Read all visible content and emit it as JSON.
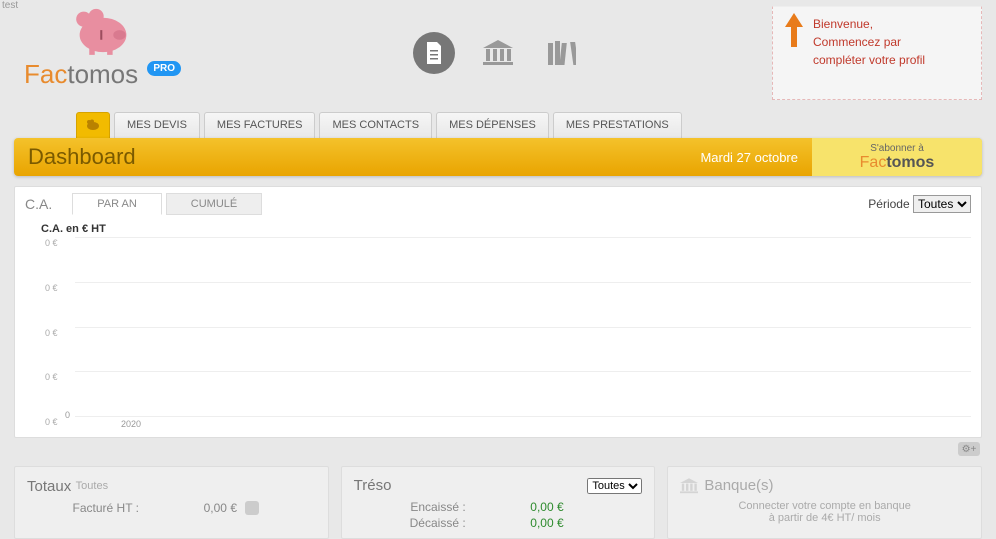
{
  "meta": {
    "test": "test"
  },
  "brand": {
    "fac": "Fac",
    "tomos": "tomos",
    "pro": "PRO"
  },
  "welcome": {
    "line1": "Bienvenue,",
    "line2": "Commencez par",
    "line3": "compléter votre profil"
  },
  "tabs": {
    "home_icon": "home",
    "devis": "MES DEVIS",
    "factures": "MES FACTURES",
    "contacts": "MES CONTACTS",
    "depenses": "MES DÉPENSES",
    "prestations": "MES PRESTATIONS"
  },
  "dashboard": {
    "title": "Dashboard",
    "date": "Mardi 27 octobre"
  },
  "subscribe": {
    "label": "S'abonner à",
    "fac": "Fac",
    "tomos": "tomos"
  },
  "ca": {
    "label": "C.A.",
    "par_an": "PAR AN",
    "cumule": "CUMULÉ",
    "period_label": "Période",
    "period_selected": "Toutes"
  },
  "chart_data": {
    "type": "bar",
    "title": "C.A. en € HT",
    "categories": [
      "2020"
    ],
    "values": [
      0
    ],
    "ylabel": "€",
    "yticks": [
      "0 €",
      "0 €",
      "0 €",
      "0 €",
      "0 €"
    ],
    "ylim": [
      0,
      0
    ]
  },
  "totaux": {
    "title": "Totaux",
    "sub": "Toutes",
    "facture_label": "Facturé HT :",
    "facture_value": "0,00 €"
  },
  "treso": {
    "title": "Tréso",
    "selected": "Toutes",
    "encaisse_label": "Encaissé :",
    "encaisse_value": "0,00 €",
    "decaisse_label": "Décaissé :",
    "decaisse_value": "0,00 €"
  },
  "banque": {
    "title": "Banque(s)",
    "line1": "Connecter votre compte en banque",
    "line2": "à partir de 4€ HT/ mois"
  }
}
